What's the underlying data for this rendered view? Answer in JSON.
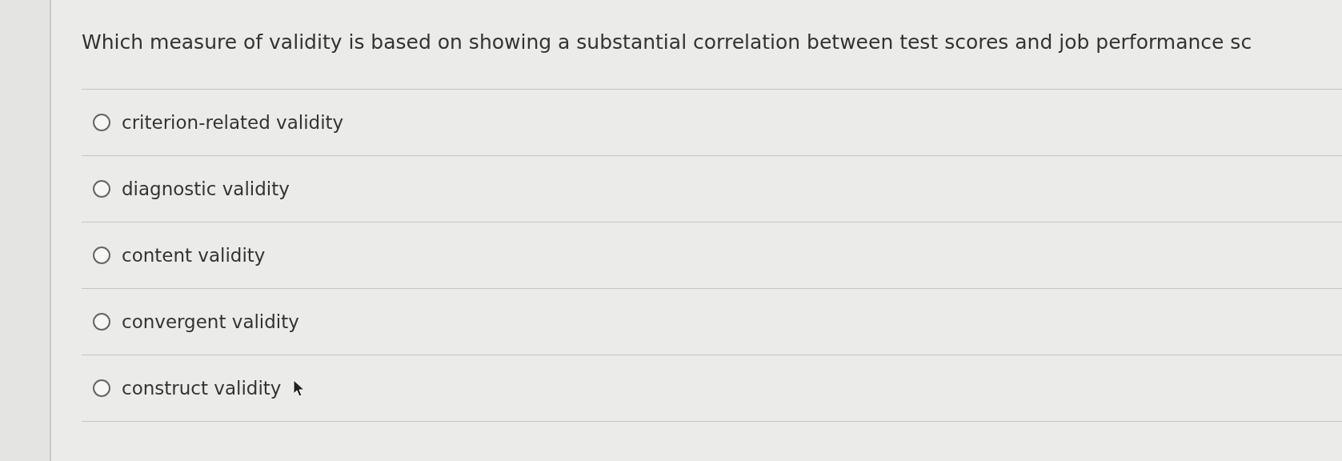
{
  "question": "Which measure of validity is based on showing a substantial correlation between test scores and job performance sc",
  "options": [
    {
      "label": "criterion-related validity",
      "selected": false
    },
    {
      "label": "diagnostic validity",
      "selected": false
    },
    {
      "label": "content validity",
      "selected": false
    },
    {
      "label": "convergent validity",
      "selected": false
    },
    {
      "label": "construct validity",
      "selected": false
    }
  ]
}
